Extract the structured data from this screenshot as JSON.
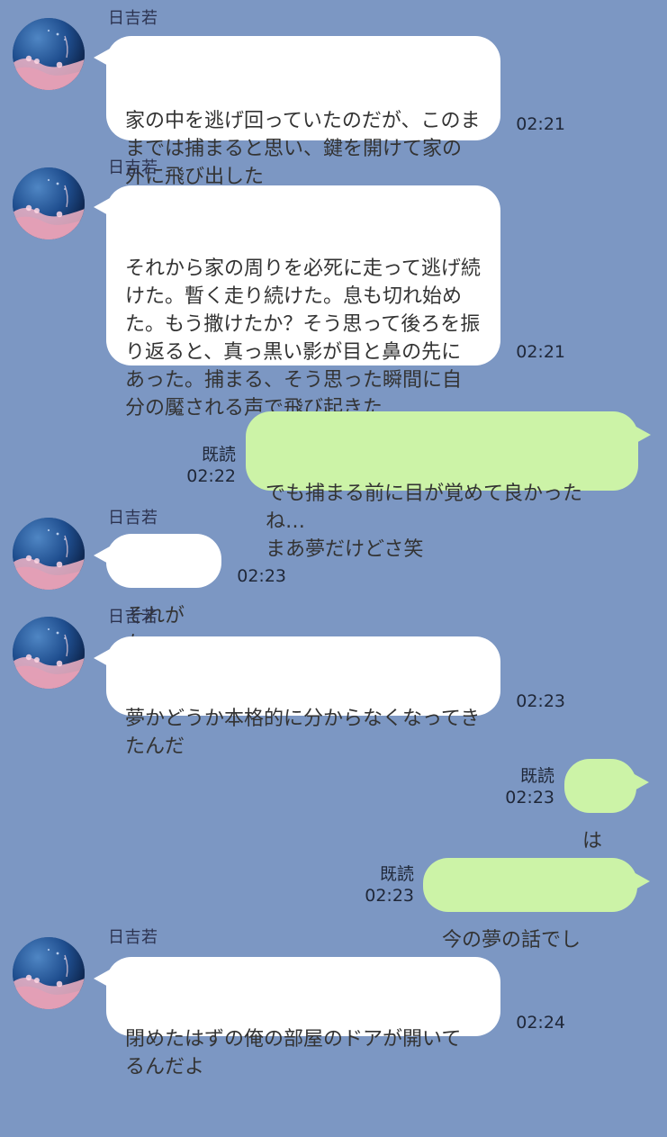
{
  "conversation": {
    "messages": [
      {
        "sender": "日吉若",
        "text": "家の中を逃げ回っていたのだが、このままでは捕まると思い、鍵を開けて家の外に飛び出した",
        "time": "02:21"
      },
      {
        "sender": "日吉若",
        "text": "それから家の周りを必死に走って逃げ続けた。暫く走り続けた。息も切れ始めた。もう撒けたか？そう思って後ろを振り返ると、真っ黒い影が目と鼻の先にあった。捕まる、そう思った瞬間に自分の魘される声で飛び起きた",
        "time": "02:21"
      },
      {
        "read": "既読",
        "text": "でも捕まる前に目が覚めて良かったね…\nまあ夢だけどさ笑",
        "time": "02:22"
      },
      {
        "sender": "日吉若",
        "text": "それがな",
        "time": "02:23"
      },
      {
        "sender": "日吉若",
        "text": "夢かどうか本格的に分からなくなってきたんだ",
        "time": "02:23"
      },
      {
        "read": "既読",
        "text": "は？",
        "time": "02:23"
      },
      {
        "read": "既読",
        "text": "今の夢の話でしょ？",
        "time": "02:23"
      },
      {
        "sender": "日吉若",
        "text": "閉めたはずの俺の部屋のドアが開いてるんだよ",
        "time": "02:24"
      }
    ]
  }
}
